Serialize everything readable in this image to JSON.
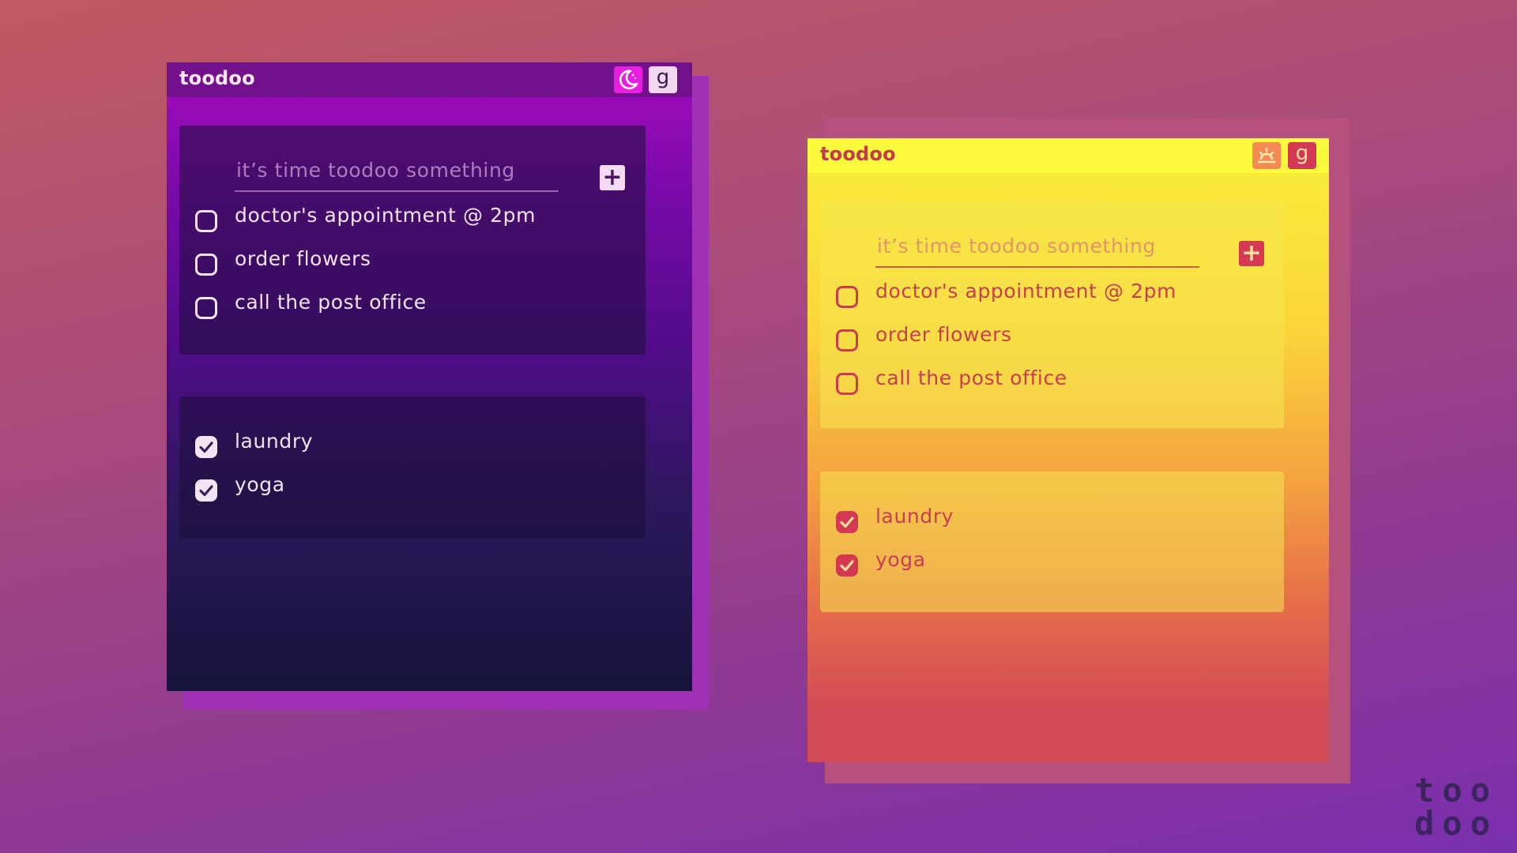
{
  "dark_window": {
    "title": "toodoo",
    "theme_icon": "moon-icon",
    "g_label": "g",
    "input_placeholder": "it’s time toodoo something",
    "add_label": "+",
    "todo_items": [
      {
        "label": "doctor's appointment @ 2pm",
        "checked": false
      },
      {
        "label": "order flowers",
        "checked": false
      },
      {
        "label": "call the post office",
        "checked": false
      }
    ],
    "done_items": [
      {
        "label": "laundry",
        "checked": true
      },
      {
        "label": "yoga",
        "checked": true
      }
    ],
    "colors": {
      "accent": "#e81ee0",
      "title_bar": "#73118c"
    }
  },
  "light_window": {
    "title": "toodoo",
    "theme_icon": "sunrise-icon",
    "g_label": "g",
    "input_placeholder": "it’s time toodoo something",
    "add_label": "+",
    "todo_items": [
      {
        "label": "doctor's appointment @ 2pm",
        "checked": false
      },
      {
        "label": "order flowers",
        "checked": false
      },
      {
        "label": "call the post office",
        "checked": false
      }
    ],
    "done_items": [
      {
        "label": "laundry",
        "checked": true
      },
      {
        "label": "yoga",
        "checked": true
      }
    ],
    "colors": {
      "accent": "#d53a52",
      "title_bar": "#fbfa3c"
    }
  },
  "brand": {
    "line1": "too",
    "line2": "doo"
  }
}
